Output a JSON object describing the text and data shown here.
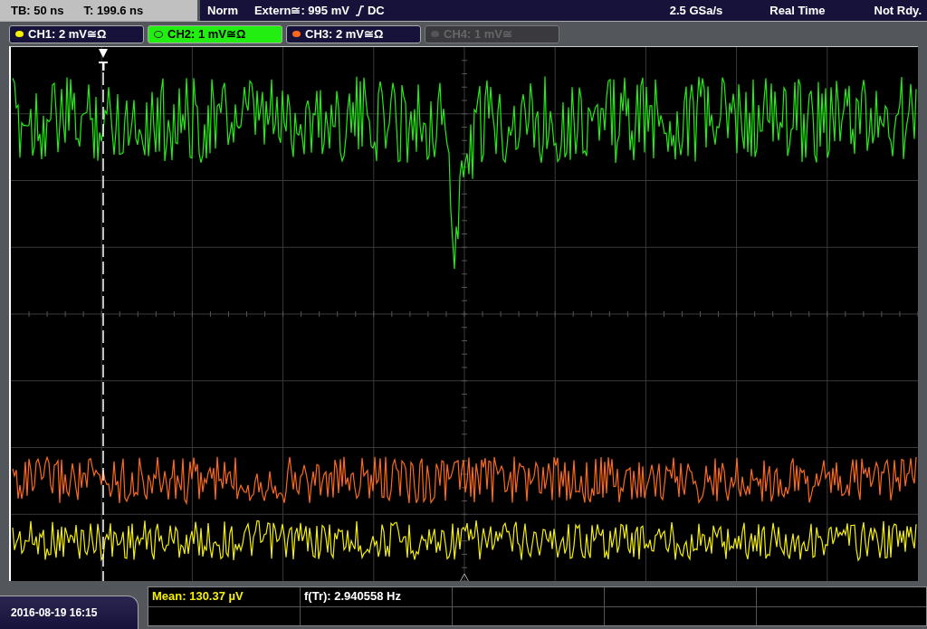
{
  "status_bar": {
    "timebase": "TB: 50 ns",
    "trigger_time": "T: 199.6 ns",
    "mode": "Norm",
    "trigger_level": "Extern≅: 995 mV",
    "coupling": "DC",
    "sample_rate": "2.5 GSa/s",
    "acquisition": "Real Time",
    "state": "Not Rdy."
  },
  "channels": [
    {
      "label": "CH1: 2 mV≅Ω",
      "color": "#f4f000",
      "selected": false,
      "disabled": false
    },
    {
      "label": "CH2: 1 mV≅Ω",
      "color": "#22ee11",
      "selected": true,
      "disabled": false
    },
    {
      "label": "CH3: 2 mV≅Ω",
      "color": "#ff6a1a",
      "selected": false,
      "disabled": false
    },
    {
      "label": "CH4: 1 mV≅",
      "color": "#555555",
      "selected": false,
      "disabled": true
    }
  ],
  "measurements": [
    {
      "text": "Mean: 130.37 µV",
      "color": "#f4f000"
    },
    {
      "text": "f(Tr): 2.940558 Hz",
      "color": "#ffffff"
    }
  ],
  "datetime": "2016-08-19 16:15"
}
